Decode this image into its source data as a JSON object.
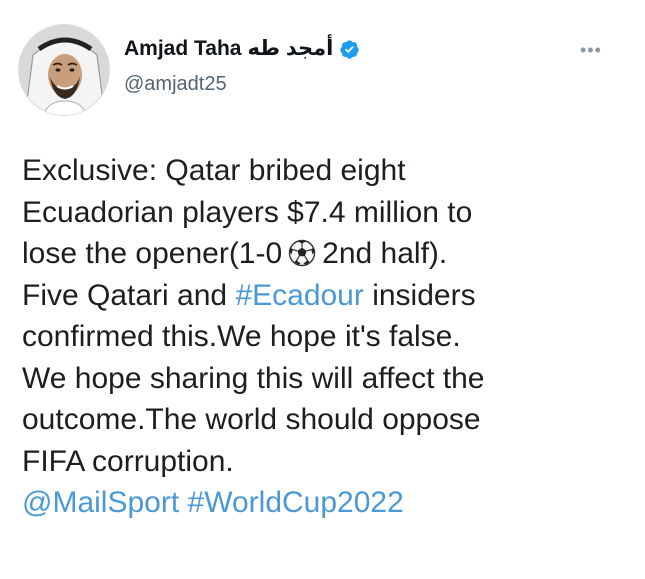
{
  "author": {
    "display_name": "Amjad Taha",
    "display_name_arabic": "أمجد طه",
    "handle": "@amjadt25",
    "verified": true,
    "verified_icon": "verified-badge-icon",
    "avatar_icon": "profile-photo"
  },
  "more_icon": "more-horizontal-icon",
  "tweet": {
    "line1": "Exclusive: Qatar bribed eight",
    "line2": "Ecuadorian players $7.4 million to",
    "line3_a": "lose the opener(1-0",
    "line3_icon": "soccer-ball-emoji",
    "line3_b": "2nd half).",
    "line4_a": "Five Qatari and ",
    "line4_hashtag": "#Ecadour",
    "line4_b": " insiders",
    "line5": "confirmed this.We hope it's false.",
    "line6": "We hope sharing this will affect the",
    "line7": "outcome.The world should oppose",
    "line8": "FIFA corruption.",
    "mention": "@MailSport",
    "hashtag_worldcup": "#WorldCup2022"
  },
  "colors": {
    "link": "#4a99d4",
    "verified": "#1d9bf0",
    "secondary_text": "#536471"
  }
}
